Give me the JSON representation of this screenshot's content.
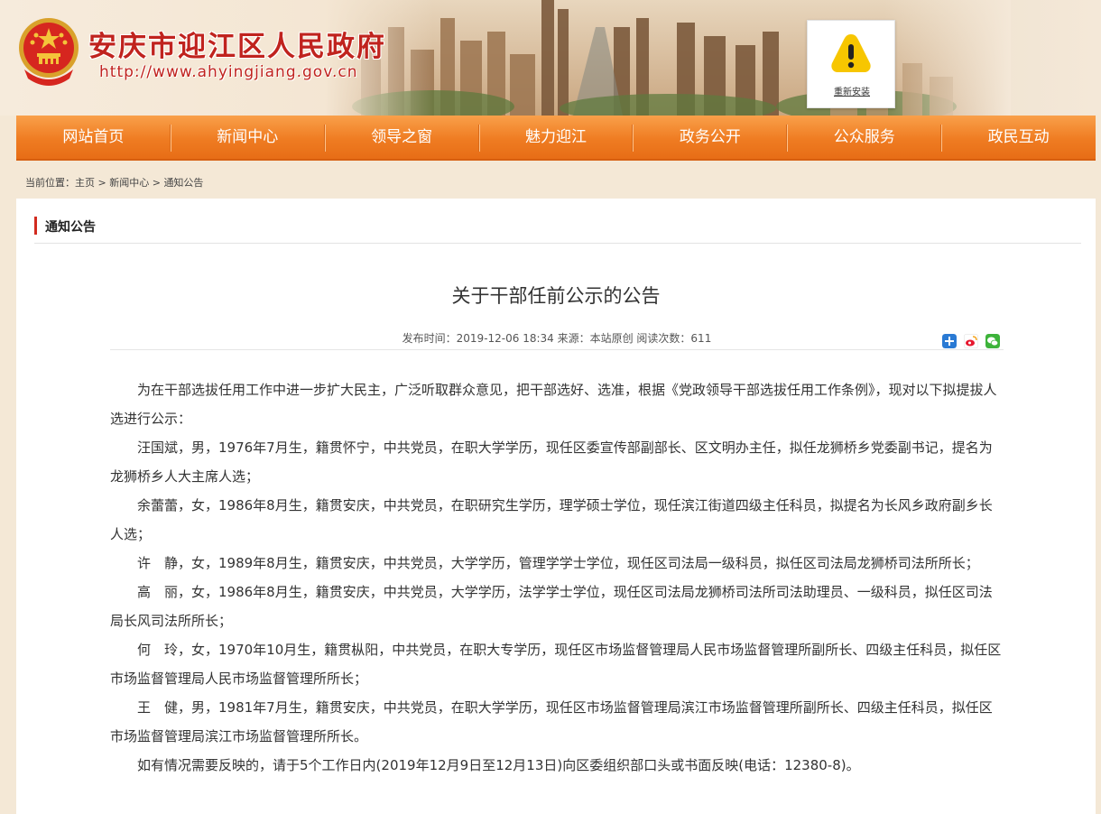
{
  "header": {
    "site_title": "安庆市迎江区人民政府",
    "site_url": "http://www.ahyingjiang.gov.cn",
    "alert_link": "重新安装",
    "brand_color": "#c0231e"
  },
  "nav": {
    "items": [
      "网站首页",
      "新闻中心",
      "领导之窗",
      "魅力迎江",
      "政务公开",
      "公众服务",
      "政民互动"
    ],
    "color": "#ef7c22"
  },
  "breadcrumb": {
    "prefix": "当前位置：",
    "home": "主页",
    "sep1": " > ",
    "news": "新闻中心",
    "sep2": " > ",
    "current": "通知公告"
  },
  "section": {
    "title": "通知公告"
  },
  "article": {
    "title": "关于干部任前公示的公告",
    "meta": "发布时间：2019-12-06 18:34 来源：本站原创 阅读次数：611",
    "paragraphs": [
      "为在干部选拔任用工作中进一步扩大民主，广泛听取群众意见，把干部选好、选准，根据《党政领导干部选拔任用工作条例》，现对以下拟提拔人选进行公示：",
      "汪国斌，男，1976年7月生，籍贯怀宁，中共党员，在职大学学历，现任区委宣传部副部长、区文明办主任，拟任龙狮桥乡党委副书记，提名为龙狮桥乡人大主席人选；",
      "余蕾蕾，女，1986年8月生，籍贯安庆，中共党员，在职研究生学历，理学硕士学位，现任滨江街道四级主任科员，拟提名为长风乡政府副乡长人选；",
      "许　静，女，1989年8月生，籍贯安庆，中共党员，大学学历，管理学学士学位，现任区司法局一级科员，拟任区司法局龙狮桥司法所所长；",
      "高　丽，女，1986年8月生，籍贯安庆，中共党员，大学学历，法学学士学位，现任区司法局龙狮桥司法所司法助理员、一级科员，拟任区司法局长风司法所所长；",
      "何　玲，女，1970年10月生，籍贯枞阳，中共党员，在职大专学历，现任区市场监督管理局人民市场监督管理所副所长、四级主任科员，拟任区市场监督管理局人民市场监督管理所所长；",
      "王　健，男，1981年7月生，籍贯安庆，中共党员，在职大学学历，现任区市场监督管理局滨江市场监督管理所副所长、四级主任科员，拟任区市场监督管理局滨江市场监督管理所所长。",
      "如有情况需要反映的，请于5个工作日内(2019年12月9日至12月13日)向区委组织部口头或书面反映(电话：12380-8)。"
    ]
  },
  "share_icons": [
    "plus-share-icon",
    "weibo-icon",
    "wechat-icon"
  ]
}
